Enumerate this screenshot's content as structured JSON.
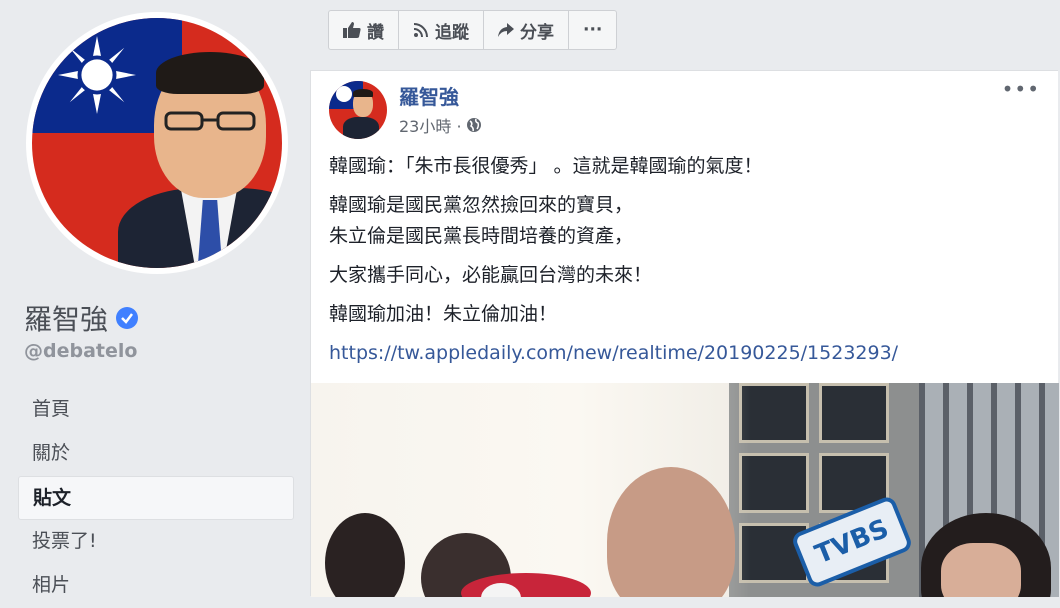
{
  "sidebar": {
    "page_name": "羅智強",
    "handle": "@debatelo",
    "nav": [
      {
        "label": "首頁"
      },
      {
        "label": "關於"
      },
      {
        "label": "貼文"
      },
      {
        "label": "投票了!"
      },
      {
        "label": "相片"
      }
    ]
  },
  "actions": {
    "like": "讚",
    "follow": "追蹤",
    "share": "分享",
    "more": "···"
  },
  "post": {
    "author": "羅智強",
    "time": "23小時 ·",
    "more": "•••",
    "lines": [
      "韓國瑜：「朱市長很優秀」 。這就是韓國瑜的氣度！",
      "韓國瑜是國民黨忽然撿回來的寶貝，",
      "朱立倫是國民黨長時間培養的資產，",
      "大家攜手同心，必能贏回台灣的未來！",
      "韓國瑜加油！朱立倫加油！"
    ],
    "link": "https://tw.appledaily.com/new/realtime/20190225/1523293/",
    "photo_logo": "TVBS"
  },
  "colors": {
    "link": "#365899",
    "flag_red": "#d52b1e",
    "flag_blue": "#0b2a8c",
    "verified": "#4080ff"
  }
}
